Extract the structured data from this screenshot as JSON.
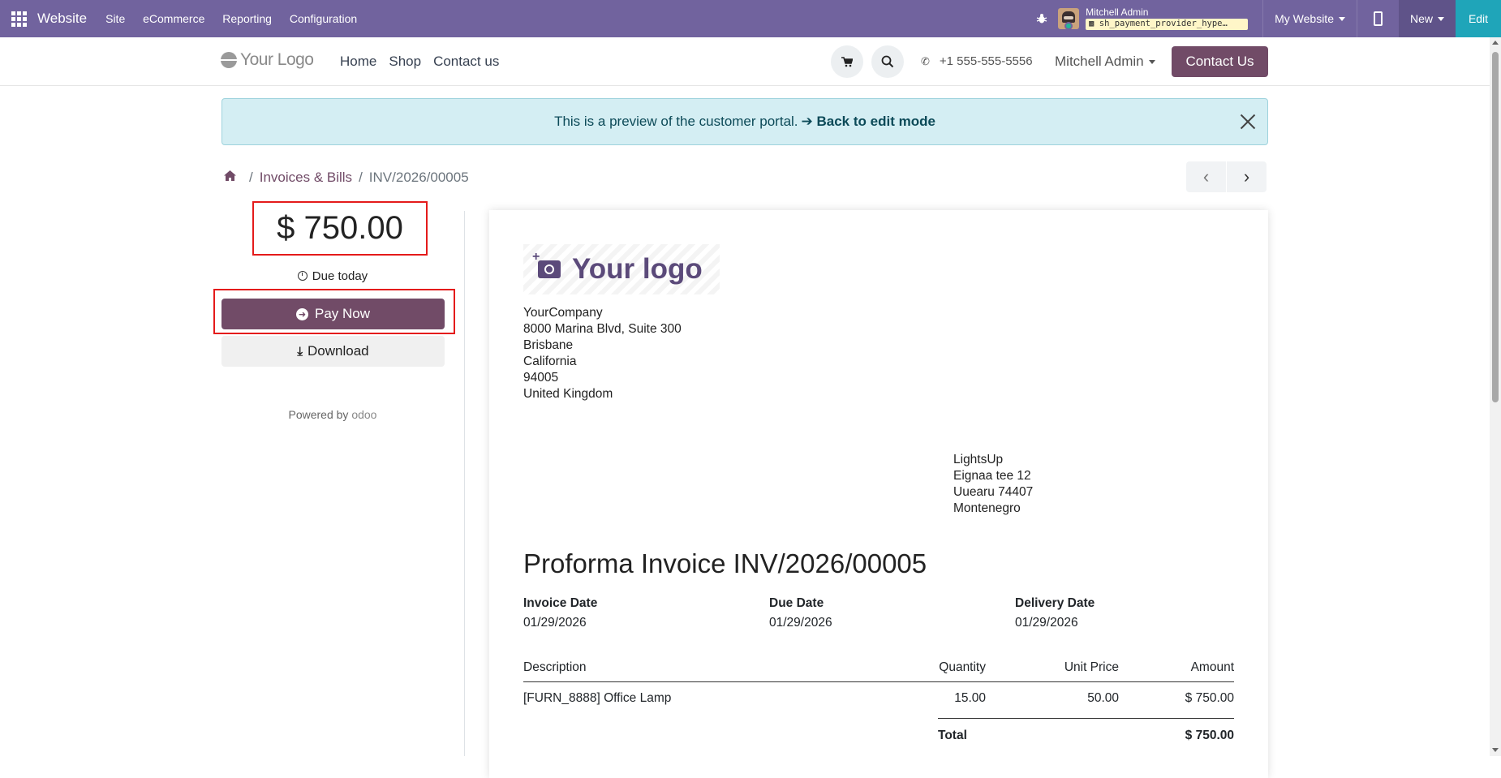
{
  "topbar": {
    "brand": "Website",
    "menu": [
      "Site",
      "eCommerce",
      "Reporting",
      "Configuration"
    ],
    "user_name": "Mitchell Admin",
    "database": "sh_payment_provider_hype…",
    "my_website": "My Website",
    "new_label": "New",
    "edit_label": "Edit"
  },
  "header": {
    "logo_text": "Your Logo",
    "nav": [
      "Home",
      "Shop",
      "Contact us"
    ],
    "phone": "+1 555-555-5556",
    "user": "Mitchell Admin",
    "contact_button": "Contact Us"
  },
  "alert": {
    "text": "This is a preview of the customer portal.",
    "link": "➔ Back to edit mode"
  },
  "breadcrumb": {
    "section": "Invoices & Bills",
    "current": "INV/2026/00005"
  },
  "sidebar": {
    "amount": "$ 750.00",
    "due": "Due today",
    "pay_label": "Pay Now",
    "download_label": "Download",
    "powered_by": "Powered by",
    "powered_brand": "odoo"
  },
  "document": {
    "logo_text": "Your logo",
    "company": [
      "YourCompany",
      "8000 Marina Blvd, Suite 300",
      "Brisbane",
      "California",
      "94005",
      "United Kingdom"
    ],
    "customer": [
      "LightsUp",
      "Eignaa tee 12",
      "Uuearu 74407",
      "Montenegro"
    ],
    "title": "Proforma Invoice INV/2026/00005",
    "info": [
      {
        "label": "Invoice Date",
        "value": "01/29/2026"
      },
      {
        "label": "Due Date",
        "value": "01/29/2026"
      },
      {
        "label": "Delivery Date",
        "value": "01/29/2026"
      }
    ],
    "columns": {
      "description": "Description",
      "quantity": "Quantity",
      "unit_price": "Unit Price",
      "amount": "Amount"
    },
    "lines": [
      {
        "description": "[FURN_8888] Office Lamp",
        "quantity": "15.00",
        "unit_price": "50.00",
        "amount": "$ 750.00"
      }
    ],
    "total_label": "Total",
    "total_value": "$ 750.00"
  }
}
